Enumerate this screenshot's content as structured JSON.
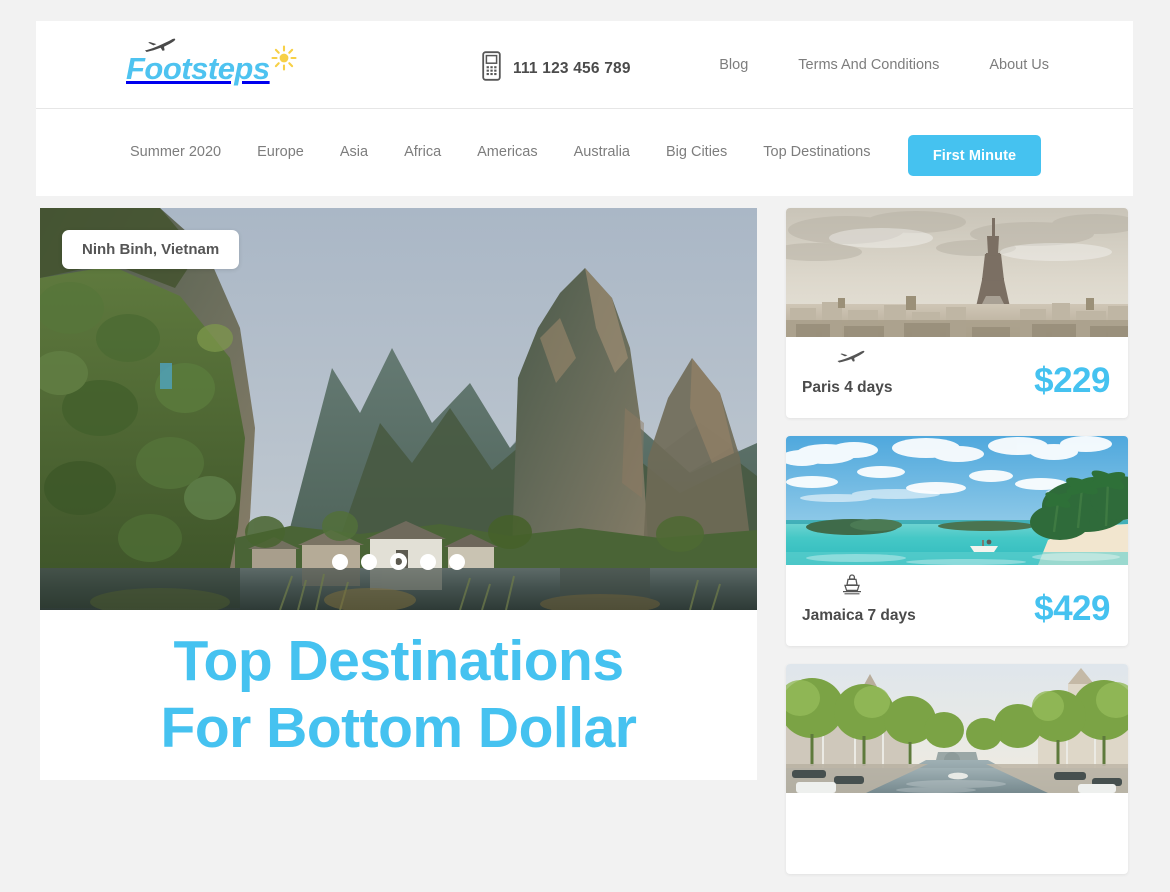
{
  "brand": {
    "name": "Footsteps",
    "plane_icon": "airplane-icon",
    "sun_icon": "sun-icon",
    "accent_color": "#45c2f0",
    "sun_color": "#f7d046"
  },
  "header": {
    "phone_icon": "mobile-phone-icon",
    "phone_number": "111 123 456 789",
    "links": [
      {
        "label": "Blog"
      },
      {
        "label": "Terms And Conditions"
      },
      {
        "label": "About Us"
      }
    ]
  },
  "nav": {
    "items": [
      {
        "label": "Summer 2020"
      },
      {
        "label": "Europe"
      },
      {
        "label": "Asia"
      },
      {
        "label": "Africa"
      },
      {
        "label": "Americas"
      },
      {
        "label": "Australia"
      },
      {
        "label": "Big Cities"
      },
      {
        "label": "Top Destinations"
      }
    ],
    "cta_label": "First Minute"
  },
  "hero": {
    "badge": "Ninh Binh, Vietnam",
    "image_alt": "ninh-binh-karst-mountains-river",
    "title_line1": "Top Destinations",
    "title_line2": "For Bottom Dollar",
    "carousel": {
      "total": 5,
      "active_index": 2
    }
  },
  "deals": [
    {
      "image_alt": "paris-eiffel-tower-skyline",
      "transport_icon": "airplane-icon",
      "label": "Paris 4 days",
      "price": "$229"
    },
    {
      "image_alt": "jamaica-tropical-beach-turquoise-water",
      "transport_icon": "cruise-ship-icon",
      "label": "Jamaica 7 days",
      "price": "$429"
    },
    {
      "image_alt": "amsterdam-canal-townhouses-boats",
      "transport_icon": "",
      "label": "",
      "price": ""
    }
  ]
}
